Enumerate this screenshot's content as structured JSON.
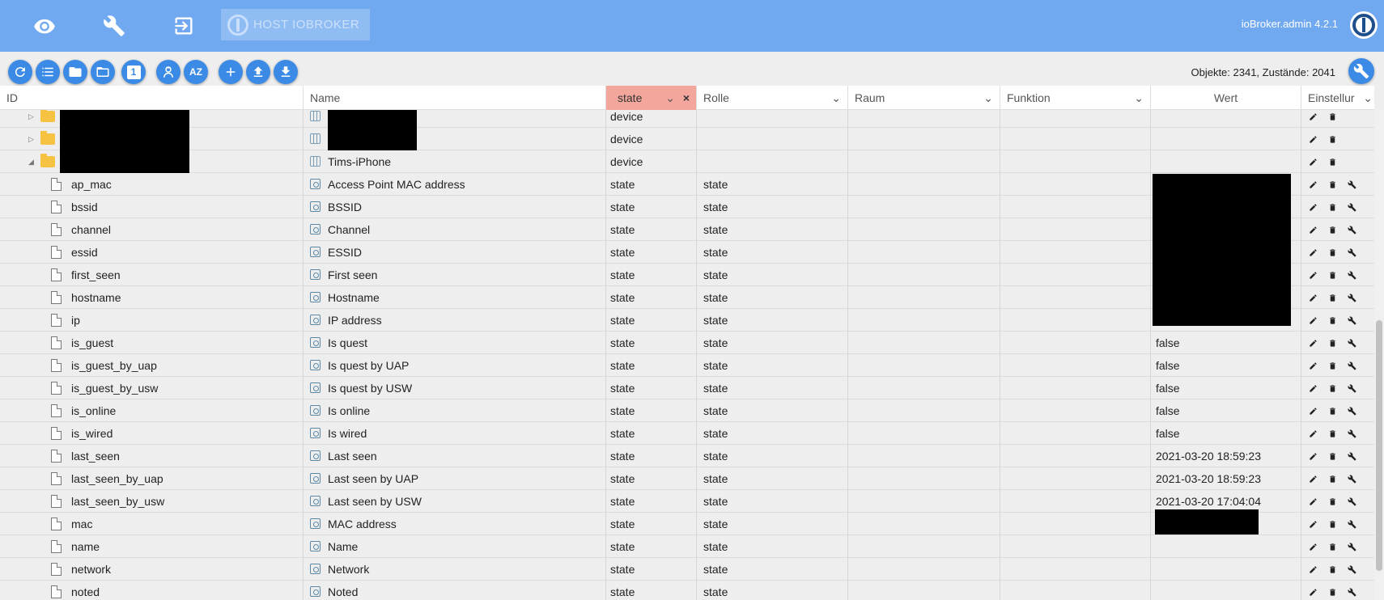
{
  "topbar": {
    "host_label": "HOST IOBROKER",
    "version": "ioBroker.admin 4.2.1",
    "icons": [
      "eye-icon",
      "wrench-icon",
      "logout-icon"
    ]
  },
  "toolbar": {
    "buttons": [
      "refresh-icon",
      "list-icon",
      "folder-icon",
      "folder-outline-icon",
      "one-icon",
      "expert-mode-icon",
      "sort-az-icon",
      "add-icon",
      "upload-icon",
      "download-icon"
    ],
    "one_label": "1",
    "sort_label": "AZ",
    "counts": "Objekte: 2341, Zustände: 2041"
  },
  "columns": {
    "id": "ID",
    "name": "Name",
    "type": "state",
    "role": "Rolle",
    "room": "Raum",
    "function": "Funktion",
    "value": "Wert",
    "settings": "Einstellur"
  },
  "rows": [
    {
      "kind": "folder",
      "id": "",
      "name": "",
      "type": "device",
      "role": "",
      "value": "",
      "redact_id": true,
      "redact_name": true,
      "expanded": false
    },
    {
      "kind": "folder",
      "id": "",
      "name": "",
      "type": "device",
      "role": "",
      "value": "",
      "redact_id": true,
      "redact_name": true,
      "expanded": false
    },
    {
      "kind": "folder",
      "id": "",
      "name": "Tims-iPhone",
      "type": "device",
      "role": "",
      "value": "",
      "redact_id": true,
      "redact_name": false,
      "expanded": true
    },
    {
      "kind": "state",
      "id": "ap_mac",
      "name": "Access Point MAC address",
      "type": "state",
      "role": "state",
      "value": ""
    },
    {
      "kind": "state",
      "id": "bssid",
      "name": "BSSID",
      "type": "state",
      "role": "state",
      "value": ""
    },
    {
      "kind": "state",
      "id": "channel",
      "name": "Channel",
      "type": "state",
      "role": "state",
      "value": ""
    },
    {
      "kind": "state",
      "id": "essid",
      "name": "ESSID",
      "type": "state",
      "role": "state",
      "value": ""
    },
    {
      "kind": "state",
      "id": "first_seen",
      "name": "First seen",
      "type": "state",
      "role": "state",
      "value": ""
    },
    {
      "kind": "state",
      "id": "hostname",
      "name": "Hostname",
      "type": "state",
      "role": "state",
      "value": ""
    },
    {
      "kind": "state",
      "id": "ip",
      "name": "IP address",
      "type": "state",
      "role": "state",
      "value": ""
    },
    {
      "kind": "state",
      "id": "is_guest",
      "name": "Is quest",
      "type": "state",
      "role": "state",
      "value": "false"
    },
    {
      "kind": "state",
      "id": "is_guest_by_uap",
      "name": "Is quest by UAP",
      "type": "state",
      "role": "state",
      "value": "false"
    },
    {
      "kind": "state",
      "id": "is_guest_by_usw",
      "name": "Is quest by USW",
      "type": "state",
      "role": "state",
      "value": "false"
    },
    {
      "kind": "state",
      "id": "is_online",
      "name": "Is online",
      "type": "state",
      "role": "state",
      "value": "false"
    },
    {
      "kind": "state",
      "id": "is_wired",
      "name": "Is wired",
      "type": "state",
      "role": "state",
      "value": "false"
    },
    {
      "kind": "state",
      "id": "last_seen",
      "name": "Last seen",
      "type": "state",
      "role": "state",
      "value": "2021-03-20 18:59:23"
    },
    {
      "kind": "state",
      "id": "last_seen_by_uap",
      "name": "Last seen by UAP",
      "type": "state",
      "role": "state",
      "value": "2021-03-20 18:59:23"
    },
    {
      "kind": "state",
      "id": "last_seen_by_usw",
      "name": "Last seen by USW",
      "type": "state",
      "role": "state",
      "value": "2021-03-20 17:04:04"
    },
    {
      "kind": "state",
      "id": "mac",
      "name": "MAC address",
      "type": "state",
      "role": "state",
      "value": ""
    },
    {
      "kind": "state",
      "id": "name",
      "name": "Name",
      "type": "state",
      "role": "state",
      "value": ""
    },
    {
      "kind": "state",
      "id": "network",
      "name": "Network",
      "type": "state",
      "role": "state",
      "value": ""
    },
    {
      "kind": "state",
      "id": "noted",
      "name": "Noted",
      "type": "state",
      "role": "state",
      "value": ""
    }
  ],
  "colors": {
    "topbar": "#71a9f1",
    "button": "#3b8be6",
    "filter_active": "#f3a79c"
  }
}
